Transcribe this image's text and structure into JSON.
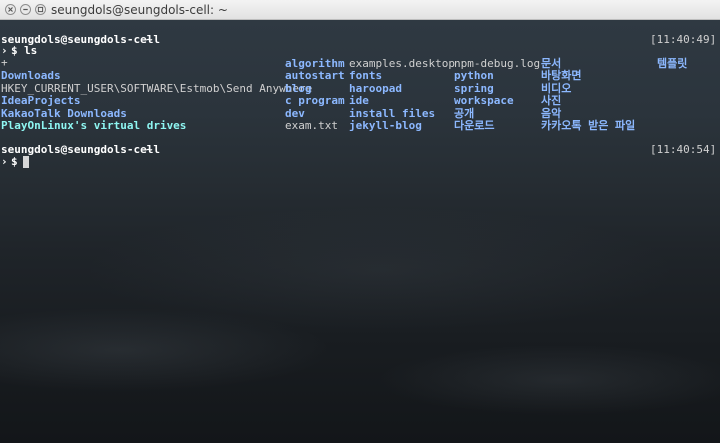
{
  "window": {
    "title": "seungdols@seungdols-cell: ~"
  },
  "prompt1": {
    "user_host": "seungdols@seungdols-cell",
    "path": "~",
    "timestamp": "[11:40:49]",
    "symbol": "$",
    "command": "ls"
  },
  "ls": {
    "col1": [
      "+",
      "Downloads",
      "HKEY_CURRENT_USER\\SOFTWARE\\Estmob\\Send Anywhere",
      "IdeaProjects",
      "KakaoTalk Downloads",
      "PlayOnLinux's virtual drives"
    ],
    "col2": [
      "algorithm",
      "autostart",
      "blog",
      "c program",
      "dev",
      "exam.txt"
    ],
    "col3": [
      "examples.desktop",
      "fonts",
      "haroopad",
      "ide",
      "install files",
      "jekyll-blog"
    ],
    "col4": [
      "npm-debug.log",
      "python",
      "spring",
      "workspace",
      "공개",
      "다운로드"
    ],
    "col5": [
      "문서",
      "바탕화면",
      "비디오",
      "사진",
      "음악",
      "카카오톡 받은 파일"
    ],
    "col6": [
      "템플릿"
    ]
  },
  "prompt2": {
    "user_host": "seungdols@seungdols-cell",
    "path": "~",
    "timestamp": "[11:40:54]",
    "symbol": "$"
  }
}
